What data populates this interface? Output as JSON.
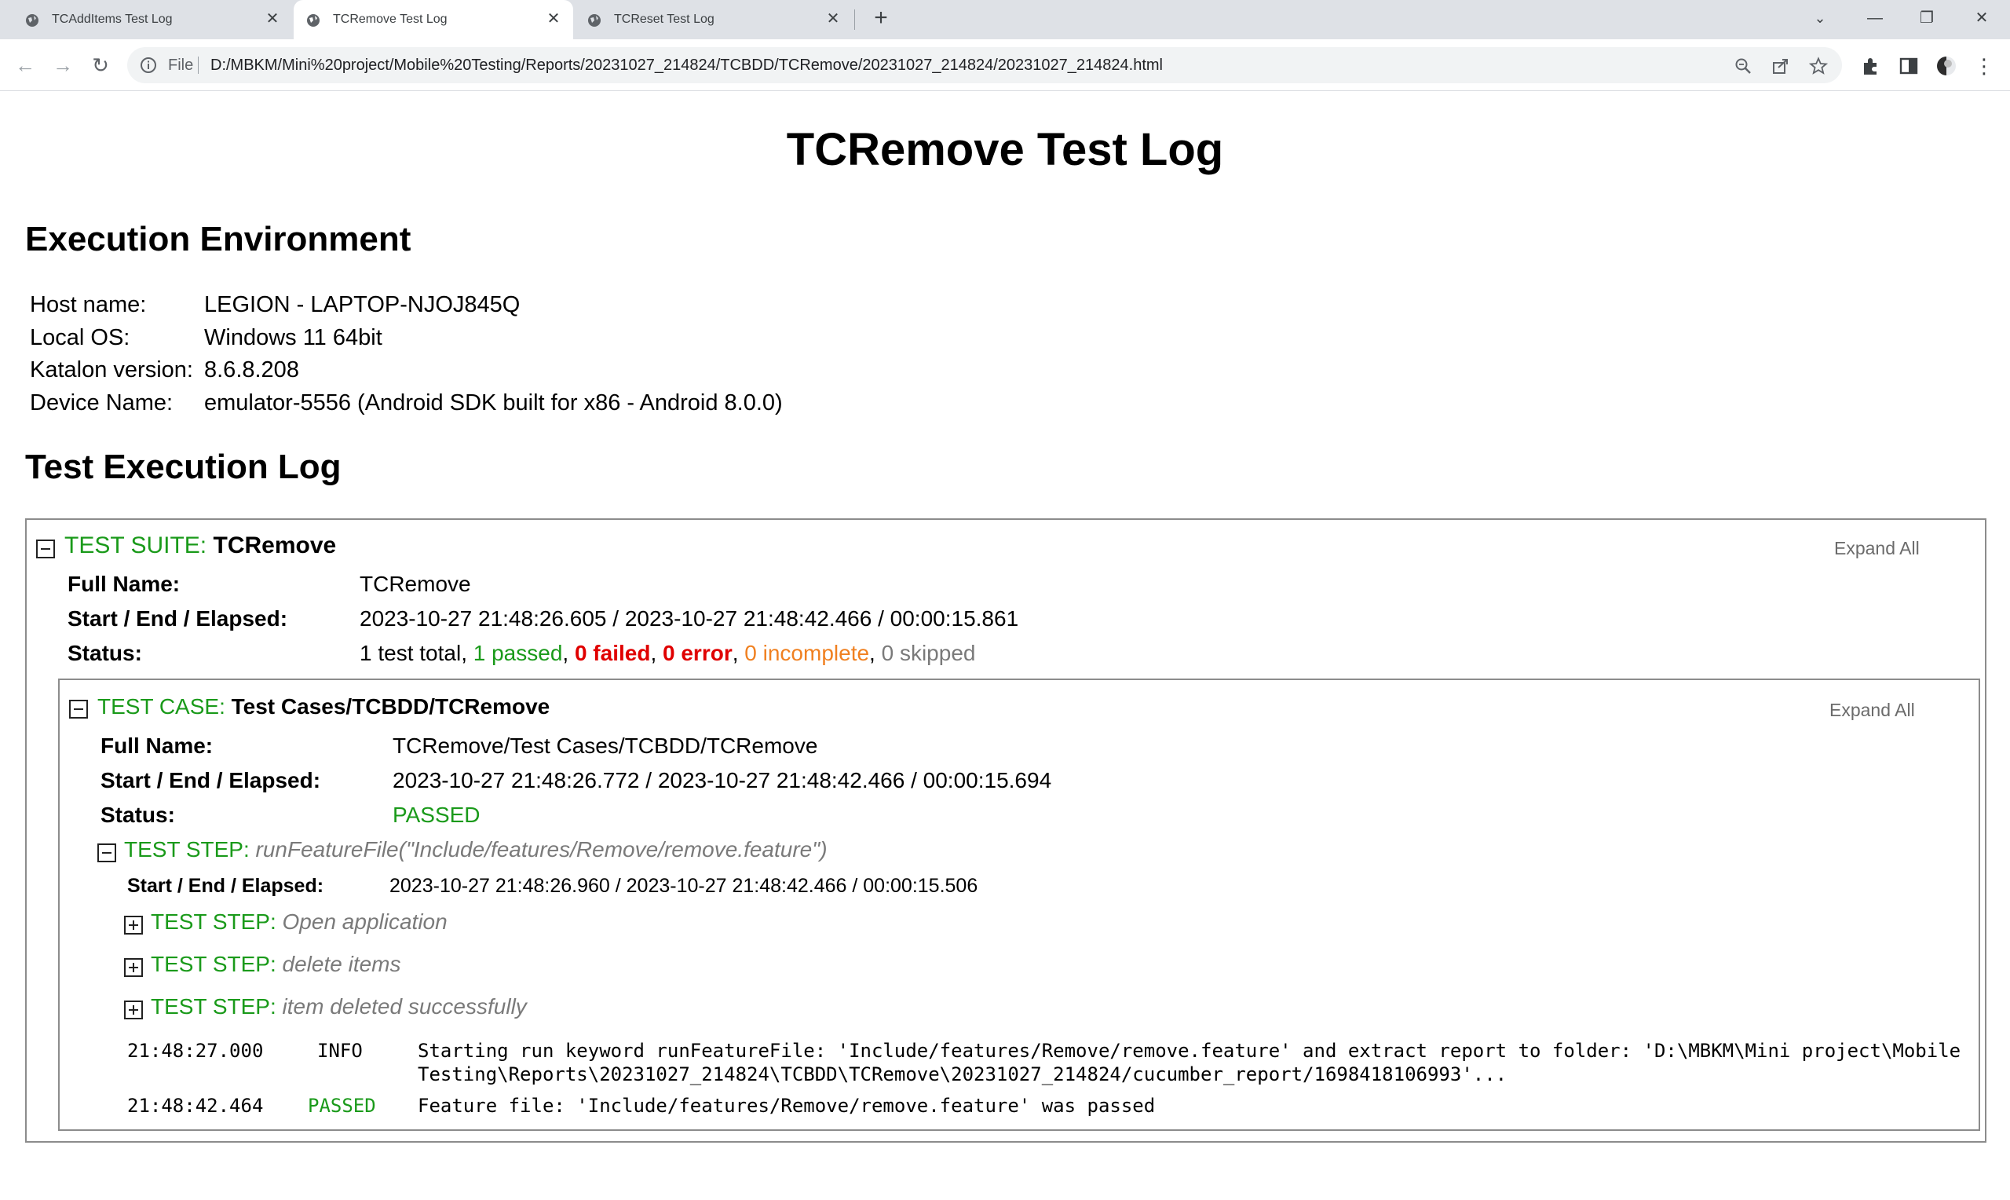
{
  "browser": {
    "tabs": [
      {
        "title": "TCAddItems Test Log"
      },
      {
        "title": "TCRemove Test Log"
      },
      {
        "title": "TCReset Test Log"
      }
    ],
    "file_label": "File",
    "url": "D:/MBKM/Mini%20project/Mobile%20Testing/Reports/20231027_214824/TCBDD/TCRemove/20231027_214824/20231027_214824.html"
  },
  "report": {
    "title": "TCRemove Test Log",
    "env_heading": "Execution Environment",
    "env": [
      {
        "key": "Host name:",
        "value": "LEGION - LAPTOP-NJOJ845Q"
      },
      {
        "key": "Local OS:",
        "value": "Windows 11 64bit"
      },
      {
        "key": "Katalon version:",
        "value": "8.6.8.208"
      },
      {
        "key": "Device Name:",
        "value": "emulator-5556 (Android SDK built for x86 - Android 8.0.0)"
      }
    ],
    "log_heading": "Test Execution Log",
    "suite": {
      "label": "TEST SUITE:",
      "name": "TCRemove",
      "expand_all": "Expand All",
      "full_name_key": "Full Name:",
      "full_name": "TCRemove",
      "time_key": "Start / End / Elapsed:",
      "time": "2023-10-27 21:48:26.605 / 2023-10-27 21:48:42.466 / 00:00:15.861",
      "status_key": "Status:",
      "status": {
        "total": "1 test total",
        "passed": "1 passed",
        "failed": "0 failed",
        "error": "0 error",
        "incomplete": "0 incomplete",
        "skipped": "0 skipped",
        "sep": ", "
      }
    },
    "case": {
      "label": "TEST CASE:",
      "name": "Test Cases/TCBDD/TCRemove",
      "expand_all": "Expand All",
      "full_name_key": "Full Name:",
      "full_name": "TCRemove/Test Cases/TCBDD/TCRemove",
      "time_key": "Start / End / Elapsed:",
      "time": "2023-10-27 21:48:26.772 / 2023-10-27 21:48:42.466 / 00:00:15.694",
      "status_key": "Status:",
      "status": "PASSED"
    },
    "step": {
      "label": "TEST STEP:",
      "name": "runFeatureFile(\"Include/features/Remove/remove.feature\")",
      "time_key": "Start / End / Elapsed:",
      "time": "2023-10-27 21:48:26.960 / 2023-10-27 21:48:42.466 / 00:00:15.506",
      "substeps": [
        {
          "label": "TEST STEP:",
          "name": "Open application"
        },
        {
          "label": "TEST STEP:",
          "name": "delete items"
        },
        {
          "label": "TEST STEP:",
          "name": "item deleted successfully"
        }
      ],
      "logs": [
        {
          "time": "21:48:27.000",
          "level": "INFO",
          "message_line1": "Starting run keyword runFeatureFile: 'Include/features/Remove/remove.feature' and extract report to folder: 'D:\\MBKM\\Mini project\\Mobile",
          "message_line2": "Testing\\Reports\\20231027_214824\\TCBDD\\TCRemove\\20231027_214824/cucumber_report/1698418106993'..."
        },
        {
          "time": "21:48:42.464",
          "level": "PASSED",
          "message_line1": "Feature file: 'Include/features/Remove/remove.feature' was passed"
        }
      ]
    }
  },
  "colors": {
    "green": "#1a9a1a",
    "red": "#e00000",
    "orange": "#f08020",
    "grey": "#7a7a7a"
  }
}
